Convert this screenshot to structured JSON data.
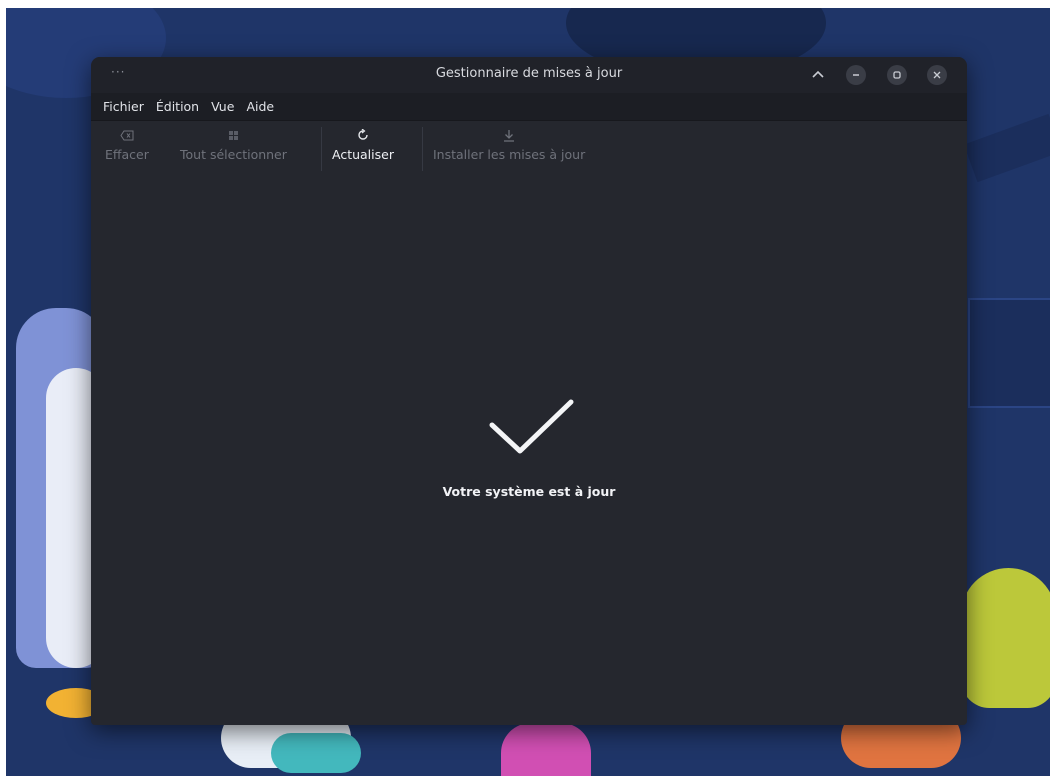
{
  "window": {
    "title": "Gestionnaire de mises à jour",
    "menu_dots": "···"
  },
  "menubar": {
    "items": [
      "Fichier",
      "Édition",
      "Vue",
      "Aide"
    ]
  },
  "toolbar": {
    "clear": {
      "label": "Effacer",
      "icon": "backspace-icon",
      "enabled": false
    },
    "select_all": {
      "label": "Tout sélectionner",
      "icon": "select-all-icon",
      "enabled": false
    },
    "refresh": {
      "label": "Actualiser",
      "icon": "refresh-icon",
      "enabled": true
    },
    "install": {
      "label": "Installer les mises à jour",
      "icon": "download-icon",
      "enabled": false
    }
  },
  "main": {
    "status_icon": "checkmark-icon",
    "status_text": "Votre système est à jour"
  },
  "colors": {
    "window_bg": "#25272e",
    "titlebar_bg": "#202229",
    "wallpaper": "#1f3568"
  }
}
